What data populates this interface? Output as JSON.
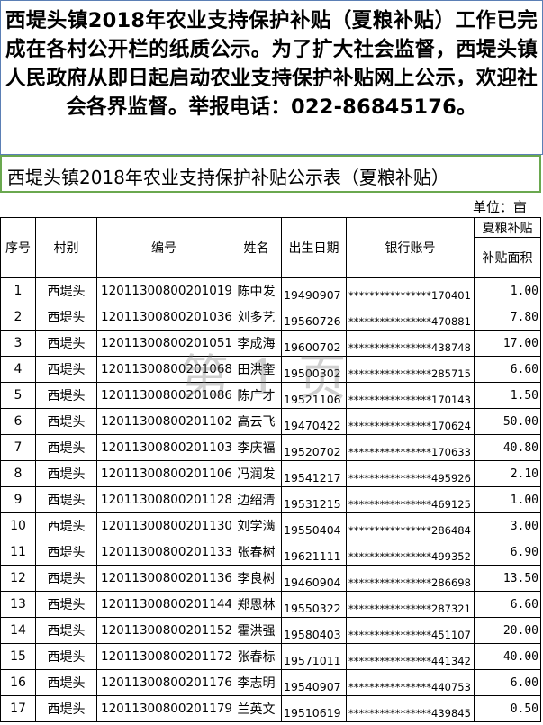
{
  "notice": {
    "text": "西堤头镇2018年农业支持保护补贴（夏粮补贴）工作已完成在各村公开栏的纸质公示。为了扩大社会监督，西堤头镇人民政府从即日起启动农业支持保护补贴网上公示，欢迎社会各界监督。举报电话：022-86845176。"
  },
  "table_title": "西堤头镇2018年农业支持保护补贴公示表（夏粮补贴）",
  "unit": "单位：亩",
  "watermark": "第 1 页",
  "headers": {
    "no": "序号",
    "village": "村别",
    "code": "编号",
    "name": "姓名",
    "dob": "出生日期",
    "account": "银行账号",
    "group": "夏粮补贴",
    "area": "补贴面积"
  },
  "rows": [
    {
      "no": "1",
      "village": "西堤头",
      "code": "12011300800201019",
      "name": "陈中发",
      "dob": "19490907",
      "account": "****************170401",
      "area": "1.00"
    },
    {
      "no": "2",
      "village": "西堤头",
      "code": "12011300800201036",
      "name": "刘多艺",
      "dob": "19560726",
      "account": "****************470881",
      "area": "7.80"
    },
    {
      "no": "3",
      "village": "西堤头",
      "code": "12011300800201051",
      "name": "李成海",
      "dob": "19600702",
      "account": "****************438748",
      "area": "17.00"
    },
    {
      "no": "4",
      "village": "西堤头",
      "code": "12011300800201068",
      "name": "田洪奎",
      "dob": "19500302",
      "account": "****************285715",
      "area": "6.60"
    },
    {
      "no": "5",
      "village": "西堤头",
      "code": "12011300800201086",
      "name": "陈广才",
      "dob": "19521106",
      "account": "****************170143",
      "area": "1.50"
    },
    {
      "no": "6",
      "village": "西堤头",
      "code": "12011300800201102",
      "name": "高云飞",
      "dob": "19470422",
      "account": "****************170624",
      "area": "50.00"
    },
    {
      "no": "7",
      "village": "西堤头",
      "code": "12011300800201103",
      "name": "李庆福",
      "dob": "19520702",
      "account": "****************170633",
      "area": "40.80"
    },
    {
      "no": "8",
      "village": "西堤头",
      "code": "12011300800201106",
      "name": "冯润发",
      "dob": "19541217",
      "account": "****************495926",
      "area": "2.10"
    },
    {
      "no": "9",
      "village": "西堤头",
      "code": "12011300800201128",
      "name": "边绍清",
      "dob": "19531215",
      "account": "****************469125",
      "area": "1.00"
    },
    {
      "no": "10",
      "village": "西堤头",
      "code": "12011300800201130",
      "name": "刘学满",
      "dob": "19550404",
      "account": "****************286484",
      "area": "3.00"
    },
    {
      "no": "11",
      "village": "西堤头",
      "code": "12011300800201133",
      "name": "张春树",
      "dob": "19621111",
      "account": "****************499352",
      "area": "6.90"
    },
    {
      "no": "12",
      "village": "西堤头",
      "code": "12011300800201136",
      "name": "李良树",
      "dob": "19460904",
      "account": "****************286698",
      "area": "13.50"
    },
    {
      "no": "13",
      "village": "西堤头",
      "code": "12011300800201144",
      "name": "郑恩林",
      "dob": "19550322",
      "account": "****************287321",
      "area": "6.60"
    },
    {
      "no": "14",
      "village": "西堤头",
      "code": "12011300800201152",
      "name": "霍洪强",
      "dob": "19580403",
      "account": "****************451107",
      "area": "20.00"
    },
    {
      "no": "15",
      "village": "西堤头",
      "code": "12011300800201172",
      "name": "张春标",
      "dob": "19571011",
      "account": "****************441342",
      "area": "40.00"
    },
    {
      "no": "16",
      "village": "西堤头",
      "code": "12011300800201176",
      "name": "李志明",
      "dob": "19540907",
      "account": "****************440753",
      "area": "6.00"
    },
    {
      "no": "17",
      "village": "西堤头",
      "code": "12011300800201179",
      "name": "兰英文",
      "dob": "19510619",
      "account": "****************439845",
      "area": "0.50"
    }
  ]
}
